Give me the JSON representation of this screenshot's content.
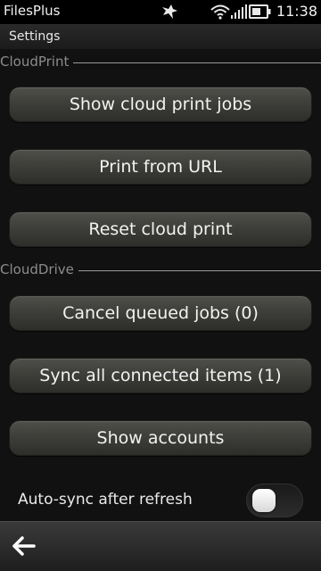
{
  "status_bar": {
    "app_name": "FilesPlus",
    "time": "11:38",
    "icons": [
      "notification-bird-icon",
      "wifi-icon",
      "signal-icon",
      "battery-icon"
    ]
  },
  "title_bar": {
    "title": "Settings"
  },
  "sections": {
    "cloud_print": {
      "label": "CloudPrint",
      "buttons": {
        "show_jobs": "Show cloud print jobs",
        "print_url": "Print from URL",
        "reset": "Reset cloud print"
      }
    },
    "cloud_drive": {
      "label": "CloudDrive",
      "buttons": {
        "cancel_queued": "Cancel queued jobs (0)",
        "sync_all": "Sync all connected items (1)",
        "show_accounts": "Show accounts"
      },
      "auto_sync": {
        "label": "Auto-sync after refresh",
        "enabled": false
      }
    }
  },
  "toolbar": {
    "back_icon": "back-arrow-icon"
  },
  "colors": {
    "background": "#111111",
    "section_label": "#8c8c8c",
    "button_text": "#f2f2f2"
  }
}
